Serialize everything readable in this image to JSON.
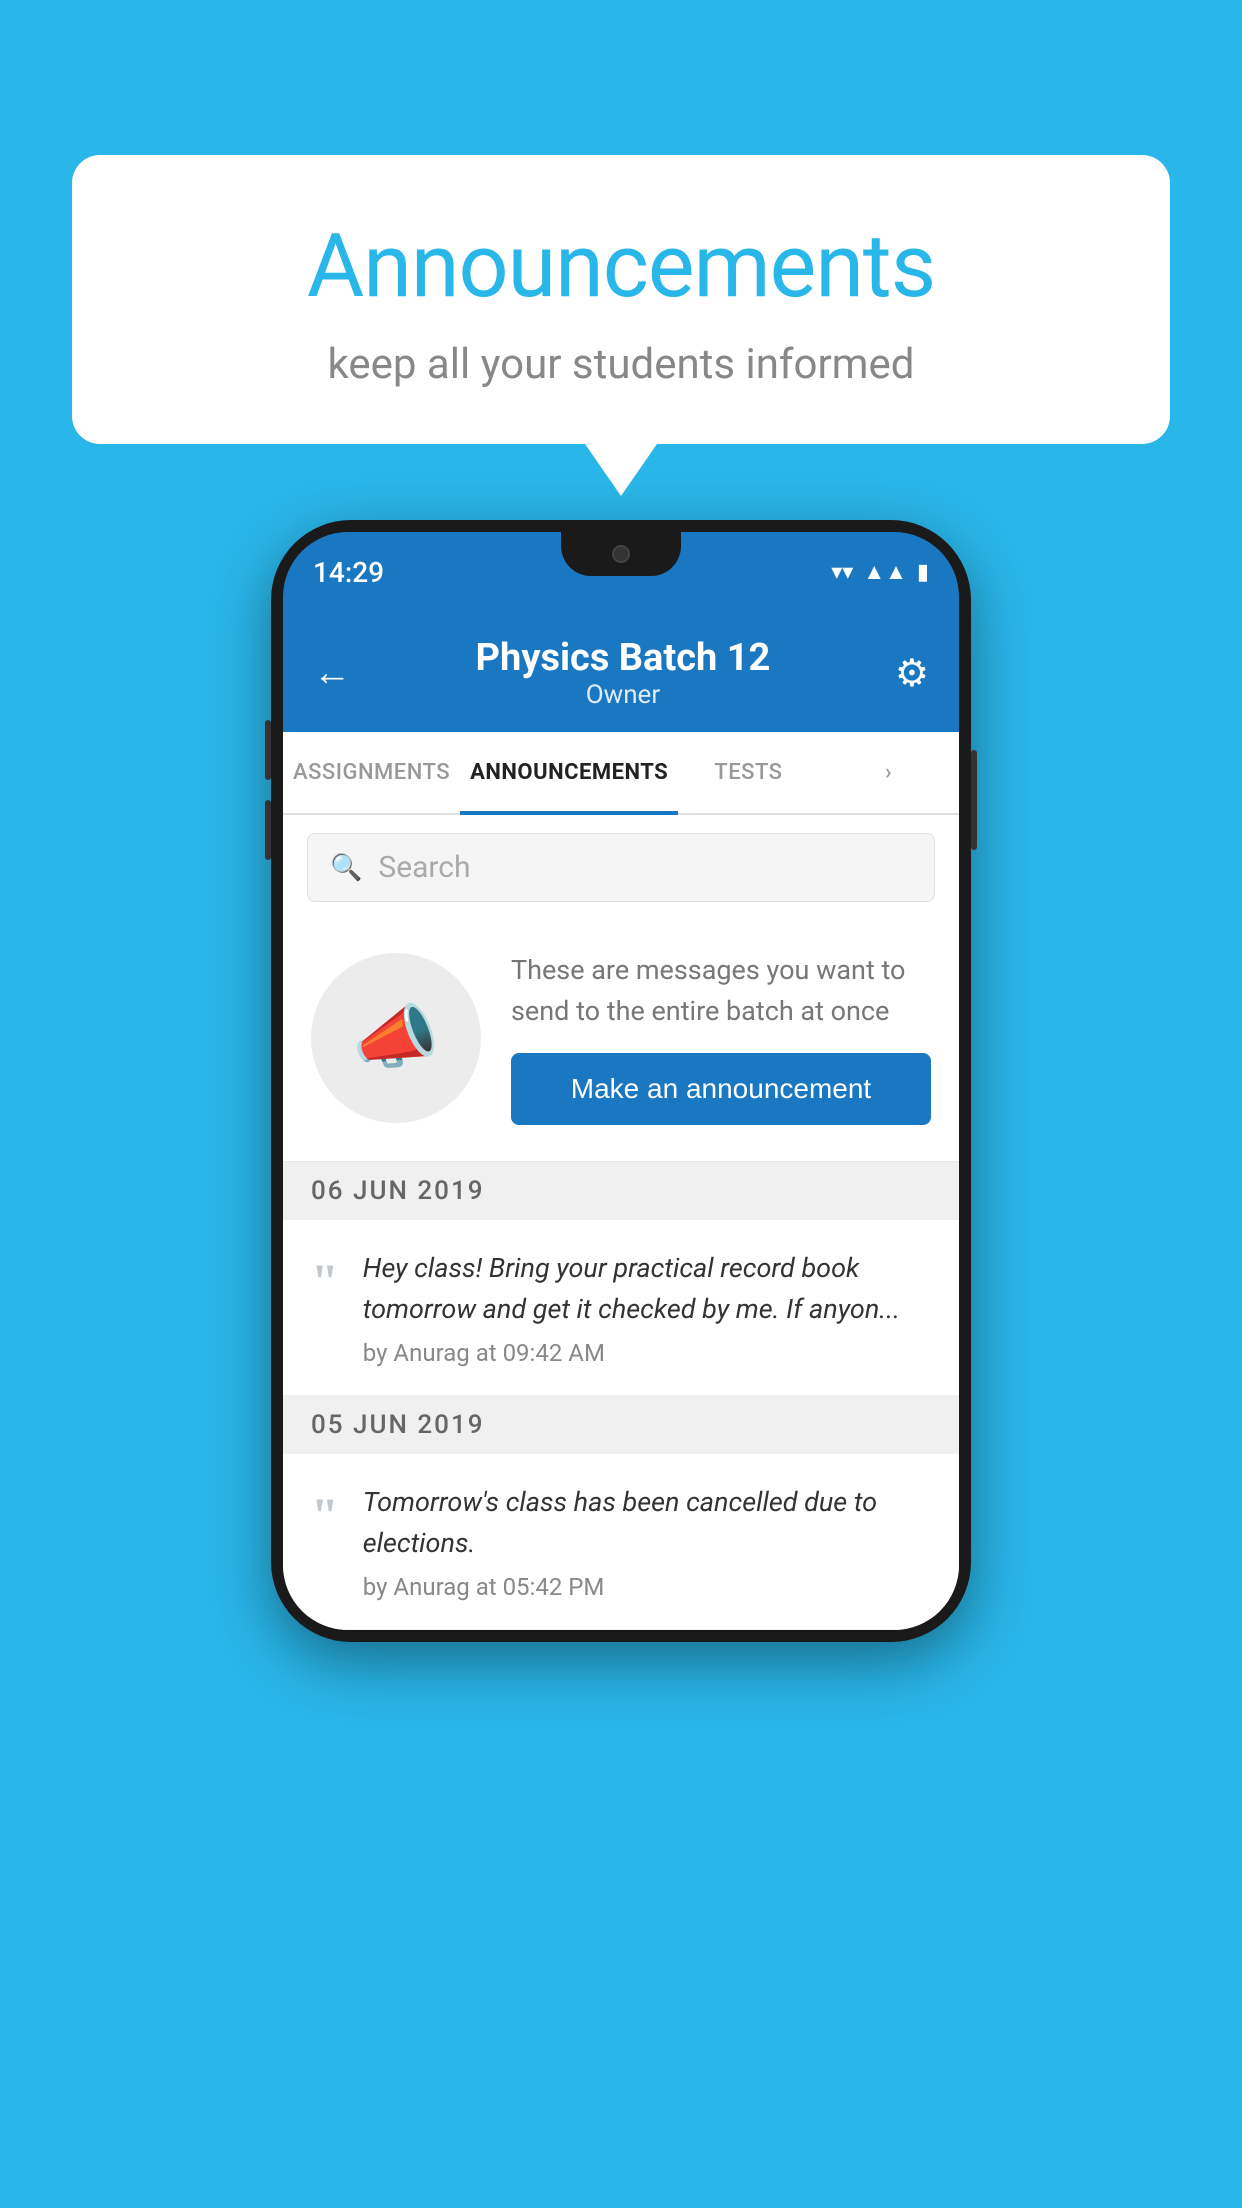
{
  "background_color": "#29b6e8",
  "speech_bubble": {
    "title": "Announcements",
    "subtitle": "keep all your students informed"
  },
  "phone": {
    "status_bar": {
      "time": "14:29",
      "wifi_icon": "wifi",
      "signal_icon": "signal",
      "battery_icon": "battery"
    },
    "header": {
      "title": "Physics Batch 12",
      "subtitle": "Owner",
      "back_label": "←",
      "settings_label": "⚙"
    },
    "tabs": [
      {
        "label": "ASSIGNMENTS",
        "active": false
      },
      {
        "label": "ANNOUNCEMENTS",
        "active": true
      },
      {
        "label": "TESTS",
        "active": false
      },
      {
        "label": "•",
        "active": false
      }
    ],
    "search": {
      "placeholder": "Search"
    },
    "promo": {
      "description": "These are messages you want to send to the entire batch at once",
      "button_label": "Make an announcement"
    },
    "announcements": [
      {
        "date": "06  JUN  2019",
        "items": [
          {
            "text": "Hey class! Bring your practical record book tomorrow and get it checked by me. If anyon...",
            "meta": "by Anurag at 09:42 AM"
          }
        ]
      },
      {
        "date": "05  JUN  2019",
        "items": [
          {
            "text": "Tomorrow's class has been cancelled due to elections.",
            "meta": "by Anurag at 05:42 PM"
          }
        ]
      }
    ]
  }
}
